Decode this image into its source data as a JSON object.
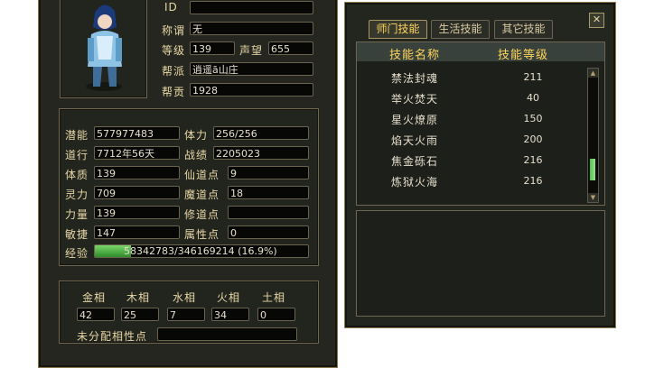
{
  "character": {
    "fields": {
      "id": {
        "label": "ID",
        "value": ""
      },
      "title": {
        "label": "称谓",
        "value": "无"
      },
      "level": {
        "label": "等级",
        "value": "139"
      },
      "prestige": {
        "label": "声望",
        "value": "655"
      },
      "guild": {
        "label": "帮派",
        "value": "逍遥ā山庄"
      },
      "contribution": {
        "label": "帮贡",
        "value": "1928"
      }
    },
    "stats": {
      "potential": {
        "label": "潜能",
        "value": "577977483"
      },
      "stamina": {
        "label": "体力",
        "value": "256/256"
      },
      "dao": {
        "label": "道行",
        "value": "7712年56天"
      },
      "battle": {
        "label": "战绩",
        "value": "2205023"
      },
      "constitution": {
        "label": "体质",
        "value": "139"
      },
      "immortal_points": {
        "label": "仙道点",
        "value": "9"
      },
      "spirit": {
        "label": "灵力",
        "value": "709"
      },
      "demon_points": {
        "label": "魔道点",
        "value": "18"
      },
      "strength": {
        "label": "力量",
        "value": "139"
      },
      "cultivation_points": {
        "label": "修道点",
        "value": ""
      },
      "agility": {
        "label": "敏捷",
        "value": "147"
      },
      "attribute_points": {
        "label": "属性点",
        "value": "0"
      },
      "experience": {
        "label": "经验",
        "value": "58342783/346169214 (16.9%)",
        "fraction": 0.169
      }
    },
    "phases": {
      "labels": [
        "金相",
        "木相",
        "水相",
        "火相",
        "土相"
      ],
      "values": [
        "42",
        "25",
        "7",
        "34",
        "0"
      ],
      "unassigned_label": "未分配相性点",
      "unassigned_value": ""
    }
  },
  "skills": {
    "tabs": [
      "师门技能",
      "生活技能",
      "其它技能"
    ],
    "active_tab": 0,
    "columns": [
      "技能名称",
      "技能等级"
    ],
    "rows": [
      {
        "name": "禁法封魂",
        "level": "211"
      },
      {
        "name": "举火焚天",
        "level": "40"
      },
      {
        "name": "星火燎原",
        "level": "150"
      },
      {
        "name": "焰天火雨",
        "level": "200"
      },
      {
        "name": "焦金砾石",
        "level": "216"
      },
      {
        "name": "炼狱火海",
        "level": "216"
      }
    ],
    "close_icon": "close-icon"
  }
}
